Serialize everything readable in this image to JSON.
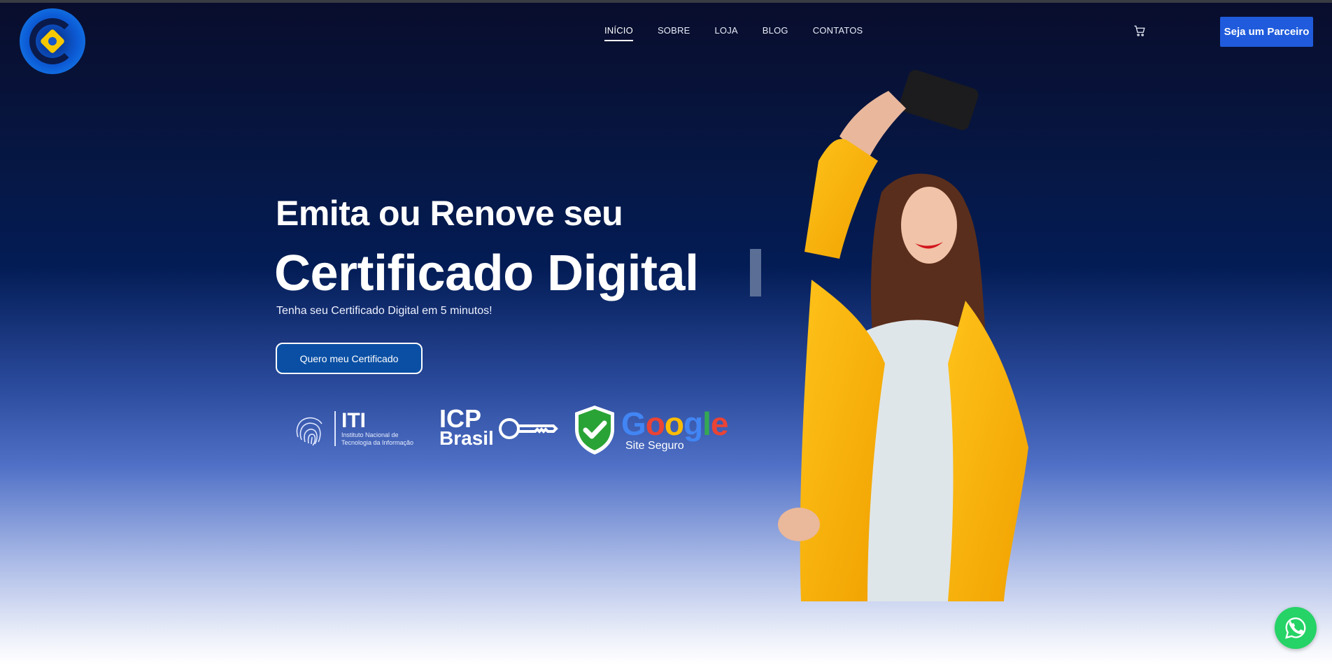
{
  "nav": {
    "items": [
      {
        "label": "INÍCIO",
        "active": true
      },
      {
        "label": "SOBRE",
        "active": false
      },
      {
        "label": "LOJA",
        "active": false
      },
      {
        "label": "BLOG",
        "active": false
      },
      {
        "label": "CONTATOS",
        "active": false
      }
    ],
    "cart_icon": "cart-icon"
  },
  "header": {
    "partner_button": "Seja um Parceiro"
  },
  "hero": {
    "line1": "Emita ou Renove seu",
    "line2": "Certificado Digital",
    "subtitle": "Tenha seu Certificado Digital em 5 minutos!",
    "cta": "Quero meu Certificado"
  },
  "badges": {
    "iti": {
      "title": "ITI",
      "line1": "Instituto Nacional de",
      "line2": "Tecnologia da Informação"
    },
    "icp": {
      "line1": "ICP",
      "line2": "Brasil"
    },
    "google": {
      "word": "Google",
      "sub": "Site Seguro"
    }
  },
  "colors": {
    "accent": "#1f5bdc",
    "cta_bg": "#0a4fa4",
    "whatsapp": "#25d366",
    "google_check": "#2aa336"
  },
  "whatsapp": {
    "icon": "whatsapp-icon"
  }
}
